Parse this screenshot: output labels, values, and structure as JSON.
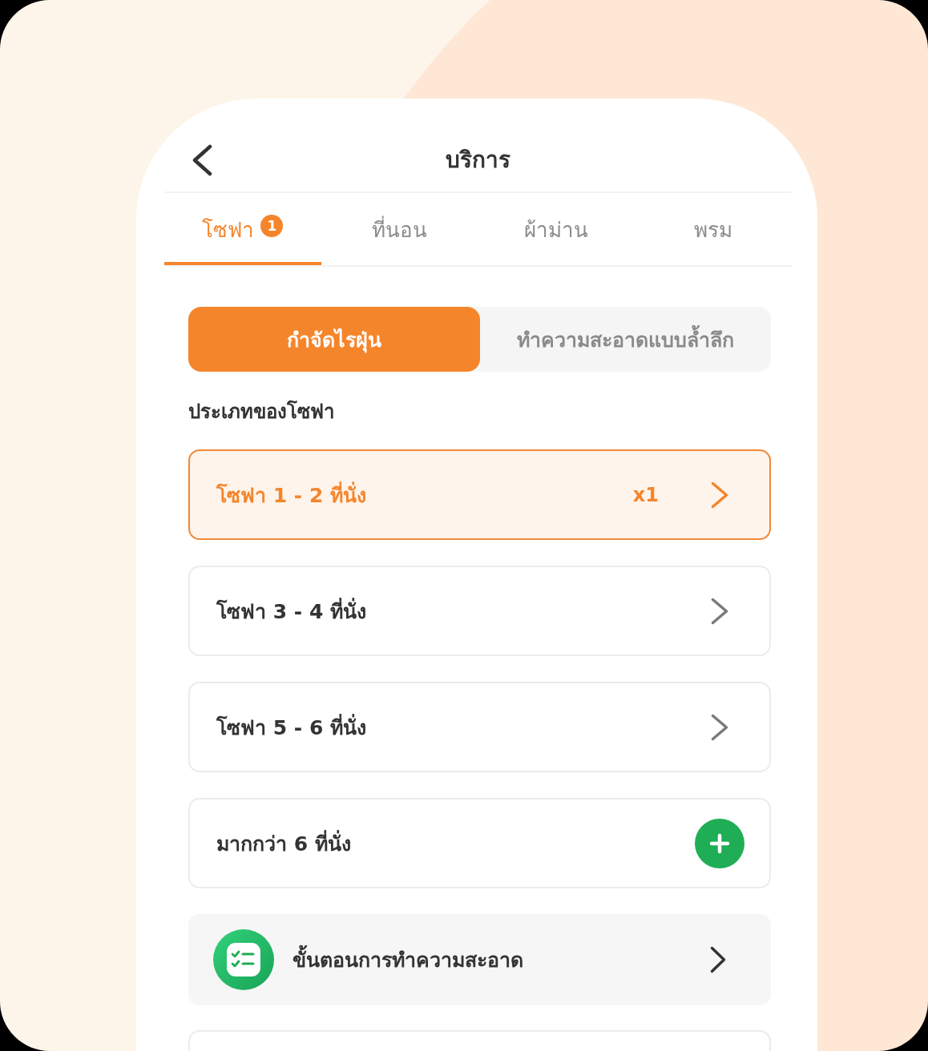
{
  "header": {
    "title": "บริการ"
  },
  "tabs": [
    {
      "label": "โซฟา",
      "badge": "1",
      "selected": true
    },
    {
      "label": "ที่นอน",
      "selected": false
    },
    {
      "label": "ผ้าม่าน",
      "selected": false
    },
    {
      "label": "พรม",
      "selected": false
    }
  ],
  "segments": [
    {
      "label": "กำจัดไรฝุ่น",
      "selected": true
    },
    {
      "label": "ทำความสะอาดแบบล้ำลึก",
      "selected": false
    }
  ],
  "section_title": "ประเภทของโซฟา",
  "options": [
    {
      "kind": "select",
      "label": "โซฟา 1 - 2 ที่นั่ง",
      "quantity": "x1",
      "selected": true
    },
    {
      "kind": "select",
      "label": "โซฟา 3 - 4 ที่นั่ง",
      "selected": false
    },
    {
      "kind": "select",
      "label": "โซฟา 5 - 6 ที่นั่ง",
      "selected": false
    },
    {
      "kind": "add",
      "label": "มากกว่า 6 ที่นั่ง",
      "selected": false
    }
  ],
  "links": [
    {
      "label": "ขั้นตอนการทำความสะอาด"
    }
  ]
}
